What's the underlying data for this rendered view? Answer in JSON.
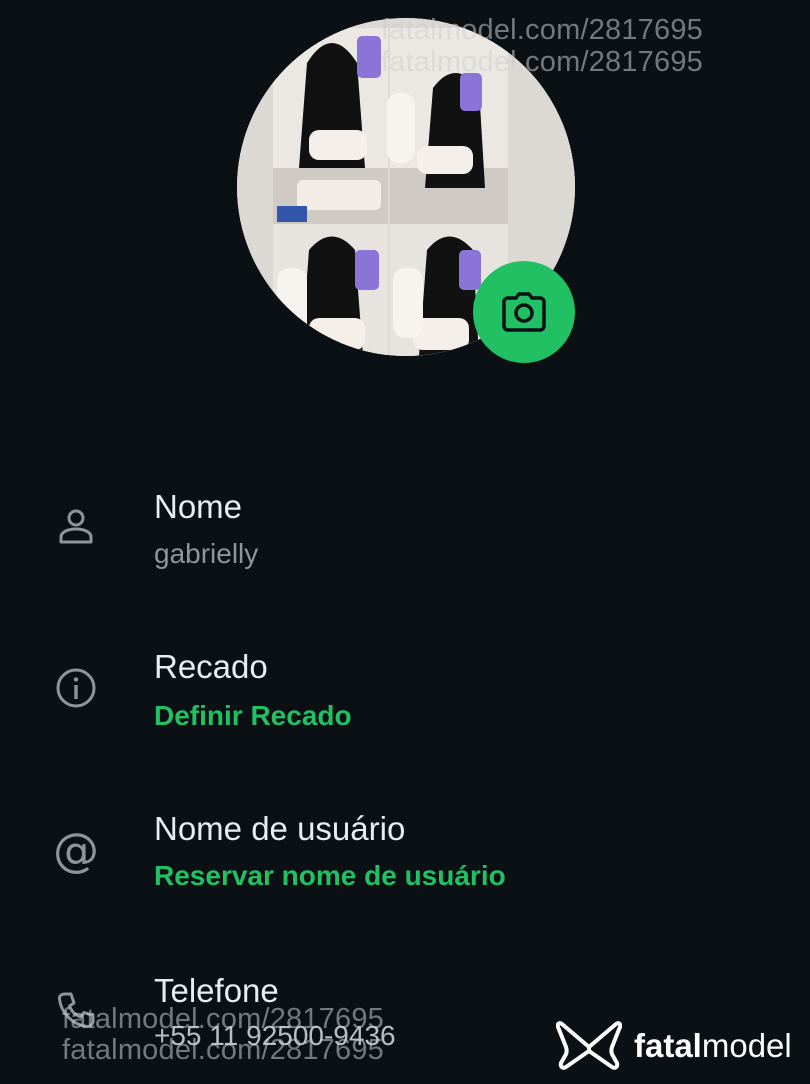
{
  "profile": {
    "photo_alt": "Profile photo collage",
    "camera_icon": "camera-icon",
    "accent_color": "#21c063"
  },
  "fields": [
    {
      "label": "Nome",
      "value": "gabrielly",
      "icon": "person-icon"
    },
    {
      "label": "Recado",
      "value": "Definir Recado",
      "icon": "info-icon"
    },
    {
      "label": "Nome de usuário",
      "value": "Reservar nome de usuário",
      "icon": "at-icon"
    },
    {
      "label": "Telefone",
      "value": "+55 11 92500-9436",
      "icon": "phone-icon"
    }
  ],
  "watermarks": {
    "top_1": "fatalmodel.com/2817695",
    "top_2": "fatalmodel.com/2817695",
    "bottom_1": "fatalmodel.com/2817695",
    "bottom_2": "fatalmodel.com/2817695"
  },
  "brand": {
    "name_bold": "fatal",
    "name_regular": "model",
    "logo_icon": "butterfly-logo-icon"
  }
}
